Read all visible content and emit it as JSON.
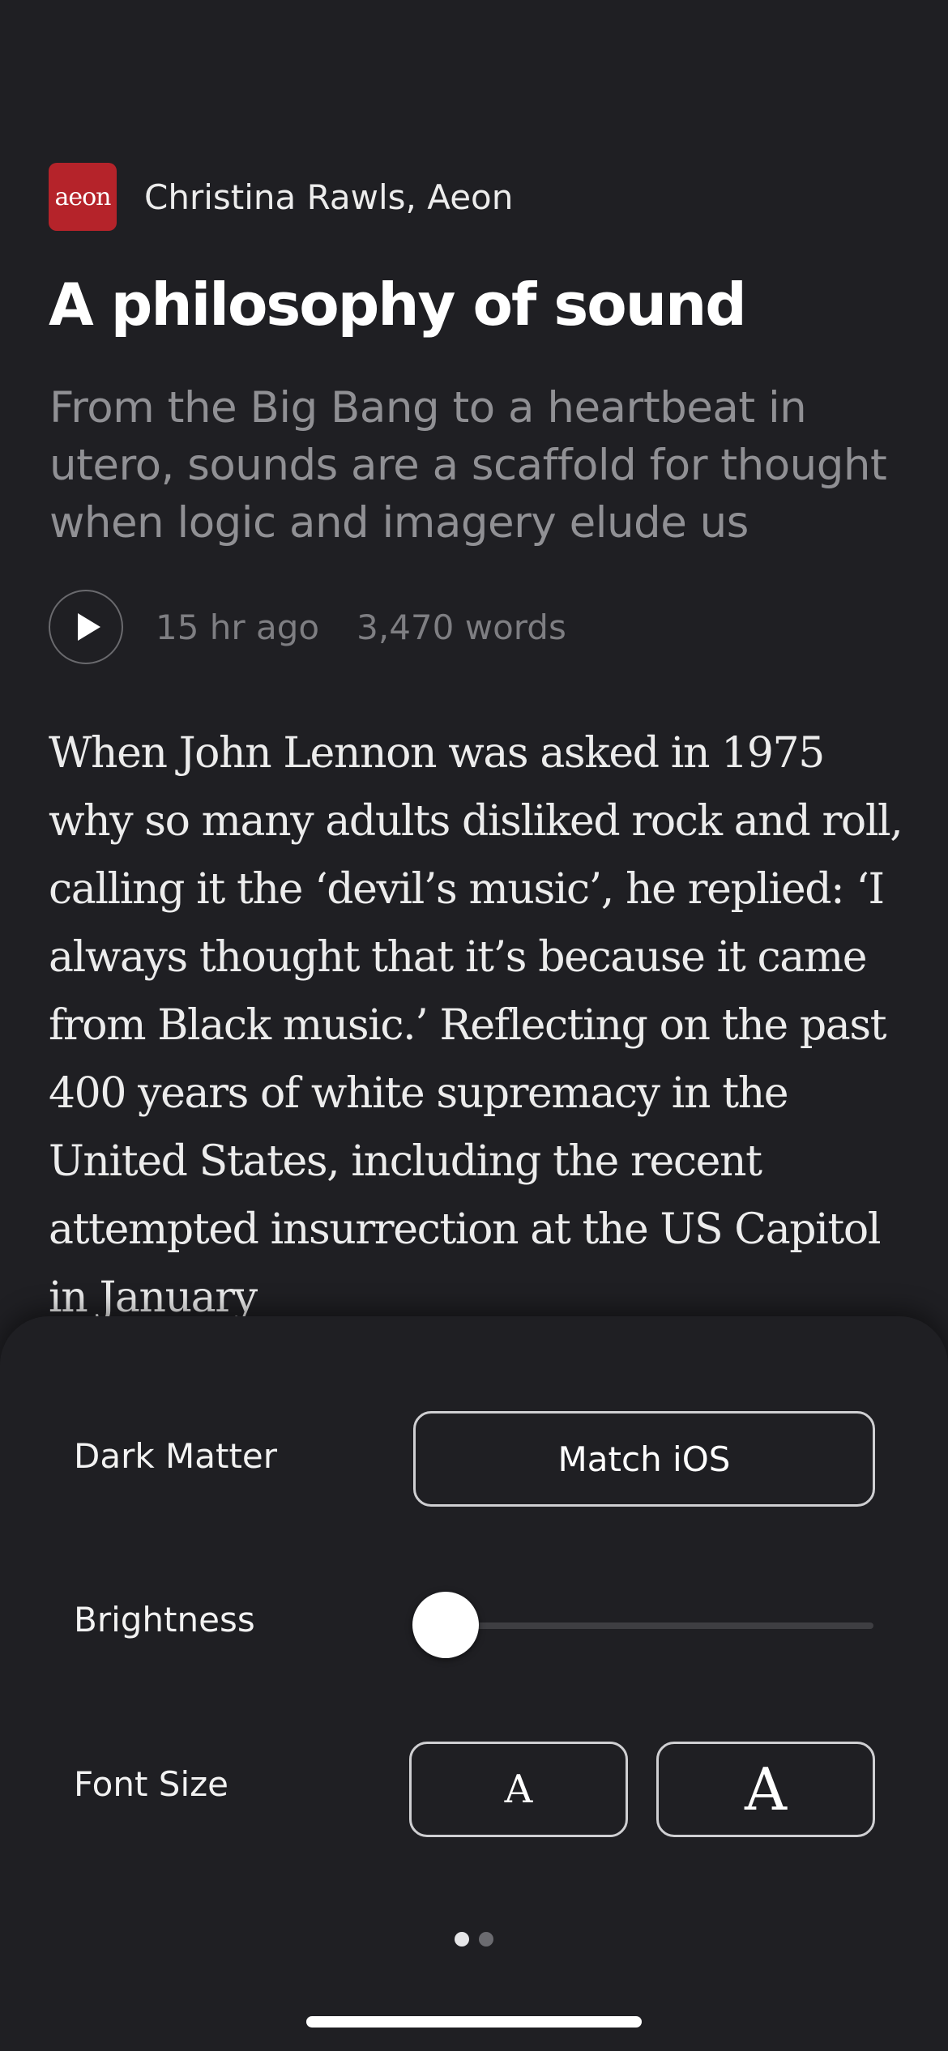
{
  "article": {
    "source_logo_text": "aeon",
    "source_name": "Christina Rawls, Aeon",
    "headline": "A philosophy of sound",
    "dek": "From the Big Bang to a heartbeat in utero, sounds are a scaffold for thought when logic and imagery elude us",
    "meta": {
      "time_ago": "15 hr ago",
      "word_count": "3,470 words"
    },
    "body": "When John Lennon was asked in 1975 why so many adults disliked rock and roll, calling it the ‘devil’s music’, he replied: ‘I always thought that it’s because it came from Black music.’ Reflecting on the past 400 years of white supremacy in the United States, including the recent attempted insurrection at the US Capitol in January"
  },
  "settings": {
    "theme_label": "Dark Matter",
    "theme_button": "Match iOS",
    "brightness_label": "Brightness",
    "brightness_value": 0.0,
    "font_size_label": "Font Size",
    "font_small": "A",
    "font_large": "A",
    "pages": {
      "count": 2,
      "current": 1
    }
  },
  "colors": {
    "background": "#1f1f23",
    "logo": "#b5232a",
    "dek": "#909094",
    "meta": "#7e7e82"
  }
}
